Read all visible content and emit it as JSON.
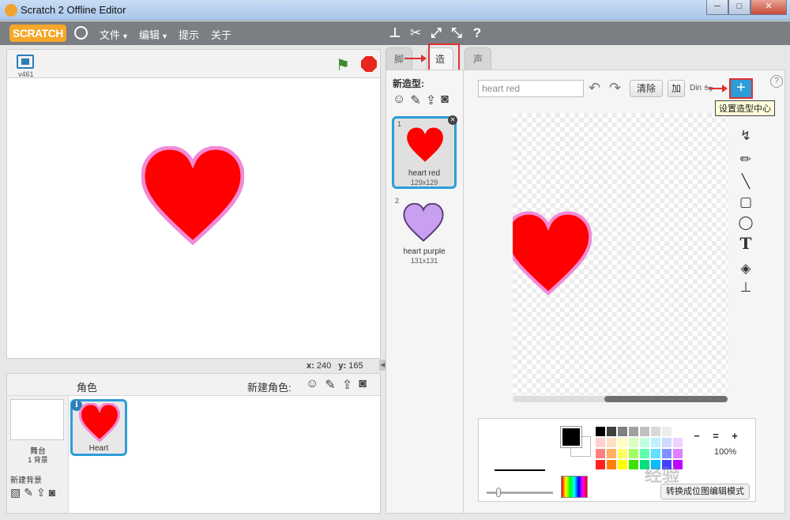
{
  "window": {
    "title": "Scratch 2 Offline Editor",
    "minimize": "─",
    "maximize": "□",
    "close": "✕"
  },
  "menu": {
    "logo": "SCRATCH",
    "file": "文件",
    "edit": "编辑",
    "tips": "提示",
    "about": "关于",
    "caret": "▼"
  },
  "stage": {
    "version": "v461",
    "x_label": "x:",
    "x_value": "240",
    "y_label": "y:",
    "y_value": "165"
  },
  "sprites": {
    "title": "角色",
    "new_sprite_label": "新建角色:",
    "stage_label": "舞台",
    "stage_bg_count": "1 背景",
    "new_bg_label": "新建背景",
    "items": [
      {
        "name": "Heart",
        "color": "#ff0000",
        "outline": "#f28ad6"
      }
    ]
  },
  "tabs": {
    "scripts": "脚本",
    "costumes": "造型",
    "sounds": "声音"
  },
  "costumes": {
    "new_costume_label": "新造型:",
    "items": [
      {
        "index": "1",
        "name": "heart red",
        "size": "129x129",
        "color": "#ff0000",
        "outline": "#f28ad6"
      },
      {
        "index": "2",
        "name": "heart purple",
        "size": "131x131",
        "color": "#c9a0f0",
        "outline": "#5a3c7a"
      }
    ]
  },
  "editor": {
    "costume_name": "heart red",
    "clear_label": "清除",
    "add_label": "加",
    "import_label": "Din",
    "tooltip": "设置造型中心",
    "zoom_level": "100%",
    "convert_label": "转换成位图编辑模式",
    "watermark": "经验",
    "zoom_out": "−",
    "zoom_reset": "=",
    "zoom_in": "+"
  },
  "colors": {
    "accent": "#2d9dd7",
    "annotation": "#e03030",
    "menu_bg": "#7b7e82",
    "palette": [
      "#000000",
      "#404040",
      "#808080",
      "#a0a0a0",
      "#c0c0c0",
      "#d8d8d8",
      "#ececec",
      "#ffffff",
      "#ffd0d0",
      "#ffe0c0",
      "#ffffc0",
      "#d8ffc0",
      "#c0ffe0",
      "#c0f0ff",
      "#d0d8ff",
      "#f0d0ff",
      "#ff8080",
      "#ffb060",
      "#ffff60",
      "#a0ff60",
      "#60ffb0",
      "#60e0ff",
      "#8090ff",
      "#e080ff",
      "#ff2020",
      "#ff8000",
      "#ffff00",
      "#40e000",
      "#00e080",
      "#00c0ff",
      "#4040ff",
      "#c000ff"
    ]
  }
}
